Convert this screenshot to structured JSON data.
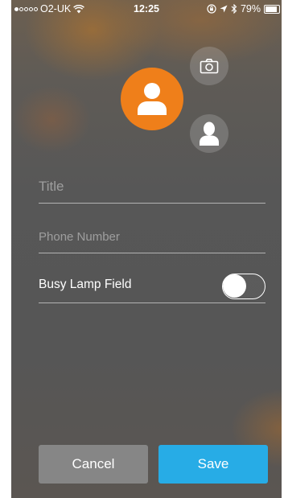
{
  "status_bar": {
    "carrier": "O2-UK",
    "time": "12:25",
    "battery": "79%",
    "battery_level": 0.79,
    "signal_dots_filled": 1,
    "signal_dots_total": 5,
    "icons": [
      "wifi-icon",
      "lock-rotation-icon",
      "location-arrow-icon",
      "bluetooth-icon",
      "battery-icon"
    ]
  },
  "avatar": {
    "icon": "person-icon",
    "color": "#ef7f1a"
  },
  "actions": {
    "camera_icon": "camera-icon",
    "contact_icon": "contact-silhouette-icon"
  },
  "form": {
    "title_placeholder": "Title",
    "phone_placeholder": "Phone Number",
    "title_value": "",
    "phone_value": "",
    "busy_lamp_label": "Busy Lamp Field",
    "busy_lamp_enabled": false
  },
  "buttons": {
    "cancel_label": "Cancel",
    "save_label": "Save",
    "cancel_color": "#868686",
    "save_color": "#27ace6"
  }
}
